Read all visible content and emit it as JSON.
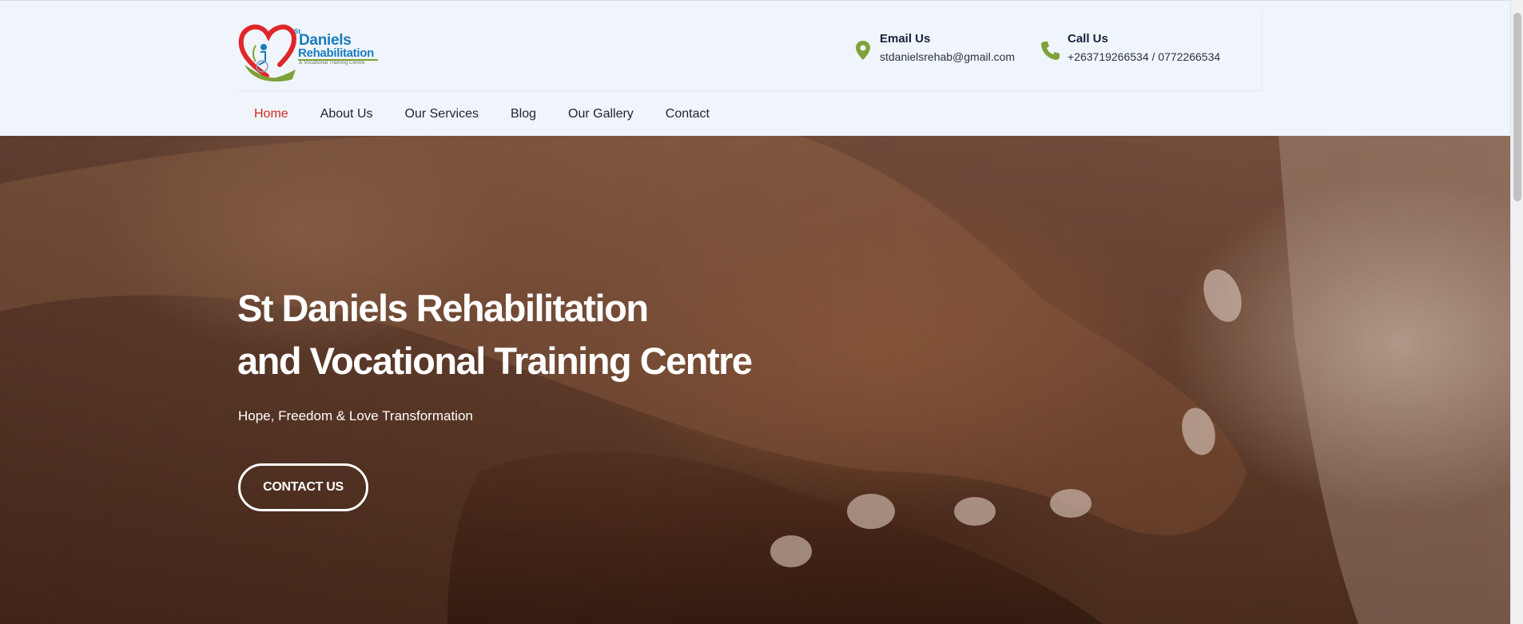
{
  "logo": {
    "alt": "St Daniels Rehabilitation & Vocational Training Centre logo",
    "st": "St",
    "line1": "Daniels",
    "line2": "Rehabilitation",
    "line3": "& Vocational Training Centre",
    "colors": {
      "heart": "#e0262b",
      "text": "#1a7bbf",
      "hand": "#7ea23a"
    }
  },
  "header": {
    "email": {
      "icon": "location-pin-icon",
      "title": "Email Us",
      "value": "stdanielsrehab@gmail.com"
    },
    "call": {
      "icon": "phone-icon",
      "title": "Call Us",
      "value": "+263719266534 / 0772266534"
    },
    "icon_color": "#7ea23a"
  },
  "nav": {
    "items": [
      {
        "label": "Home",
        "active": true
      },
      {
        "label": "About Us"
      },
      {
        "label": "Our Services"
      },
      {
        "label": "Blog"
      },
      {
        "label": "Our Gallery"
      },
      {
        "label": "Contact"
      }
    ],
    "active_color": "#d52a22"
  },
  "hero": {
    "title_line1": "St Daniels Rehabilitation",
    "title_line2": "and Vocational Training Centre",
    "subtitle": "Hope, Freedom & Love Transformation",
    "button": "CONTACT US",
    "image": "clasped-hands-photo"
  }
}
